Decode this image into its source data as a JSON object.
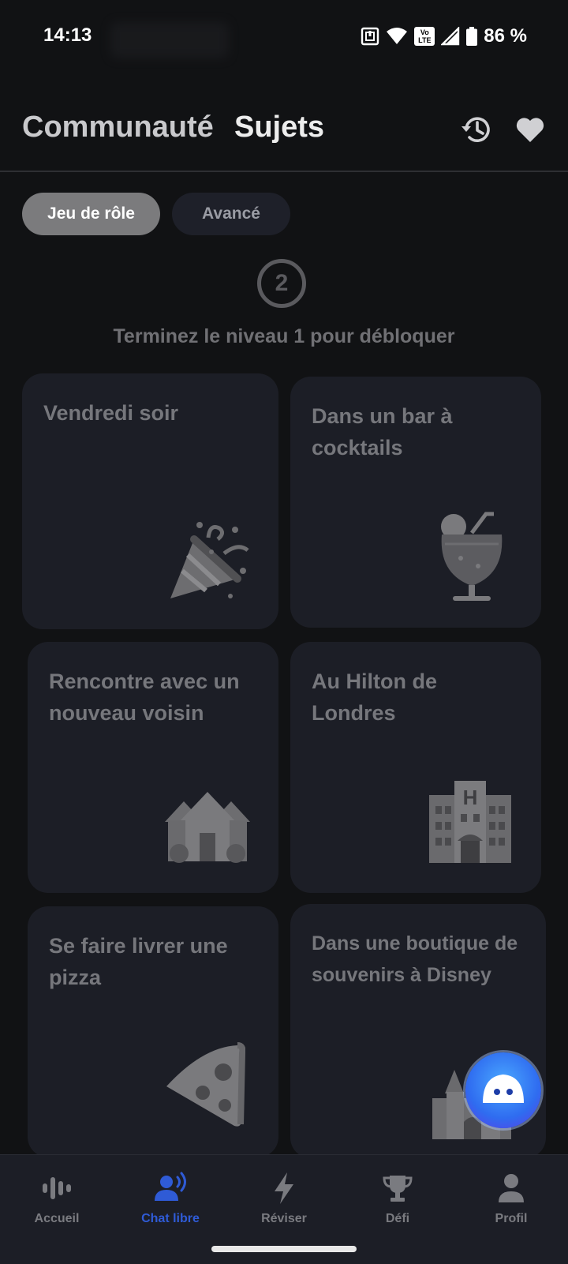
{
  "status_bar": {
    "time": "14:13",
    "battery": "86 %",
    "network": "Vo LTE"
  },
  "header": {
    "tabs": [
      {
        "label": "Communauté"
      },
      {
        "label": "Sujets"
      }
    ]
  },
  "chips": {
    "roleplay": "Jeu de rôle",
    "advanced": "Avancé"
  },
  "lock": {
    "level": "2",
    "message": "Terminez le niveau 1 pour débloquer"
  },
  "cards": [
    {
      "label": "Vendredi soir",
      "icon": "party-popper-icon"
    },
    {
      "label": "Dans un bar à cocktails",
      "icon": "cocktail-icon"
    },
    {
      "label": "Rencontre avec un nouveau voisin",
      "icon": "houses-icon"
    },
    {
      "label": "Au Hilton de Londres",
      "icon": "hotel-icon"
    },
    {
      "label": "Se faire livrer une pizza",
      "icon": "pizza-icon"
    },
    {
      "label": "Dans une boutique de souvenirs à Disney",
      "icon": "castle-icon"
    }
  ],
  "hotel_sign": "H",
  "nav": [
    {
      "label": "Accueil",
      "icon": "voice-wave-icon"
    },
    {
      "label": "Chat libre",
      "icon": "speaking-person-icon",
      "active": true
    },
    {
      "label": "Réviser",
      "icon": "lightning-icon"
    },
    {
      "label": "Défi",
      "icon": "trophy-icon"
    },
    {
      "label": "Profil",
      "icon": "person-icon"
    }
  ],
  "colors": {
    "accent": "#2f5bd6",
    "card": "#1c1e26",
    "background": "#111214"
  }
}
